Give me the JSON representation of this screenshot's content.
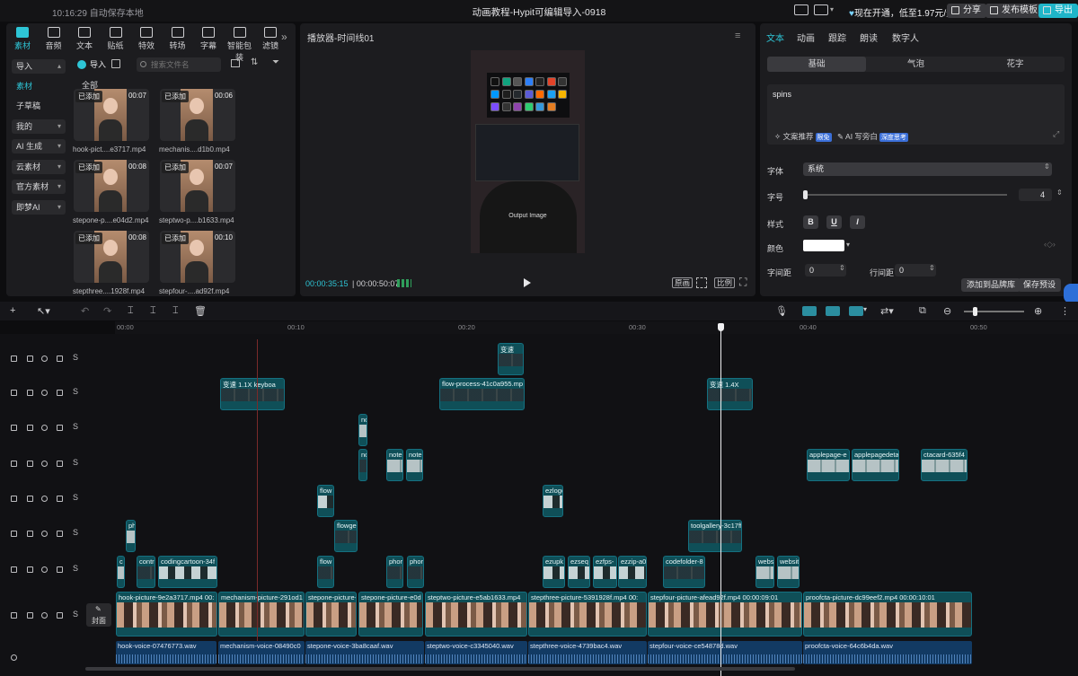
{
  "topbar": {
    "time": "10:16:29",
    "save_status": "自动保存本地",
    "title": "动画教程-Hypit可编辑导入-0918",
    "vip_text": "现在开通，低至1.97元/天",
    "share": "分享",
    "publish": "发布模板",
    "export": "导出"
  },
  "media_tabs": [
    "素材",
    "音频",
    "文本",
    "贴纸",
    "特效",
    "转场",
    "字幕",
    "智能包装",
    "滤镜"
  ],
  "sidebar": {
    "items": [
      {
        "label": "导入",
        "boxed": true,
        "dropdown": true
      },
      {
        "label": "素材",
        "boxed": false
      },
      {
        "label": "子草稿",
        "boxed": false
      },
      {
        "label": "我的",
        "boxed": true,
        "dropdown": true
      },
      {
        "label": "AI 生成",
        "boxed": true,
        "dropdown": true
      },
      {
        "label": "云素材",
        "boxed": true,
        "dropdown": true
      },
      {
        "label": "官方素材",
        "boxed": true,
        "dropdown": true
      },
      {
        "label": "即梦AI",
        "boxed": true,
        "dropdown": true
      }
    ]
  },
  "media": {
    "import_label": "导入",
    "search_placeholder": "搜索文件名",
    "all_label": "全部",
    "added_label": "已添加",
    "items": [
      {
        "name": "hook-pict....e3717.mp4",
        "duration": "00:07"
      },
      {
        "name": "mechanis....d1b0.mp4",
        "duration": "00:06"
      },
      {
        "name": "stepone-p....e04d2.mp4",
        "duration": "00:08"
      },
      {
        "name": "steptwo-p....b1633.mp4",
        "duration": "00:07"
      },
      {
        "name": "stepthree....1928f.mp4",
        "duration": "00:08"
      },
      {
        "name": "stepfour-....ad92f.mp4",
        "duration": "00:10"
      }
    ]
  },
  "player": {
    "title": "播放器-时间线01",
    "current_time": "00:00:35:15",
    "total_time": "00:00:50:07",
    "btn_original": "原画",
    "btn_ratio": "比例",
    "overlay_text": "Output Image"
  },
  "right_panel": {
    "tabs": [
      "文本",
      "动画",
      "跟踪",
      "朗读",
      "数字人"
    ],
    "segments": [
      "基础",
      "气泡",
      "花字"
    ],
    "text_value": "spins",
    "suggest1": "文案推荐",
    "suggest1_badge": "限免",
    "suggest2": "AI 写旁白",
    "suggest2_badge": "深度思考",
    "font_label": "字体",
    "font_value": "系统",
    "size_label": "字号",
    "size_value": "4",
    "size_fraction": 0.0,
    "style_label": "样式",
    "style_buttons": [
      "B",
      "U",
      "I"
    ],
    "color_label": "颜色",
    "color_value": "#ffffff",
    "spacing_label": "字间距",
    "spacing_value": "0",
    "line_spacing_label": "行间距",
    "line_spacing_value": "0",
    "btn_brand": "添加到品牌库",
    "btn_preset": "保存预设"
  },
  "ruler": [
    "00:00",
    "00:10",
    "00:20",
    "00:30",
    "00:40",
    "00:50"
  ],
  "cover_label": "封面",
  "tracks": {
    "t1": [
      {
        "label": "变速",
        "style": "dark"
      }
    ],
    "t2": [
      {
        "label": "变速 1.1X  keyboa",
        "style": "dark"
      },
      {
        "label": "flow-process-41c0a955.mp",
        "style": "dark"
      },
      {
        "label": "变速 1.4X",
        "style": "dark"
      }
    ],
    "t3": [
      {
        "label": "nc",
        "style": "light"
      }
    ],
    "t4": [
      {
        "label": "nc",
        "style": "dark"
      },
      {
        "label": "note",
        "style": "light"
      },
      {
        "label": "note",
        "style": "light"
      },
      {
        "label": "applepage-e",
        "style": "light"
      },
      {
        "label": "applepagedeta",
        "style": "light"
      },
      {
        "label": "ctacard-635f4",
        "style": "light"
      }
    ],
    "t5": [
      {
        "label": "flow",
        "style": "mix"
      },
      {
        "label": "ezlogo",
        "style": "mix"
      }
    ],
    "t6": [
      {
        "label": "ph",
        "style": "light"
      },
      {
        "label": "flowge",
        "style": "dark"
      },
      {
        "label": "toolgallery-3c17ff",
        "style": "dark"
      }
    ],
    "t7": [
      {
        "label": "c",
        "style": "light"
      },
      {
        "label": "contr",
        "style": "dark"
      },
      {
        "label": "codingcartoon-34f",
        "style": "mix"
      },
      {
        "label": "flow",
        "style": "dark"
      },
      {
        "label": "phor",
        "style": "dark"
      },
      {
        "label": "phor",
        "style": "dark"
      },
      {
        "label": "ezupk",
        "style": "mix"
      },
      {
        "label": "ezseq",
        "style": "mix"
      },
      {
        "label": "ezfps-",
        "style": "mix"
      },
      {
        "label": "ezzip-a0",
        "style": "mix"
      },
      {
        "label": "codefolder-8",
        "style": "dark"
      },
      {
        "label": "websi",
        "style": "light"
      },
      {
        "label": "websit",
        "style": "light"
      }
    ],
    "main": [
      {
        "label": "hook-picture-9e2a3717.mp4  00:"
      },
      {
        "label": "mechanism-picture-291od1"
      },
      {
        "label": "stepone-picture-"
      },
      {
        "label": "stepone-picture-e0d"
      },
      {
        "label": "steptwo-picture-e5ab1633.mp4"
      },
      {
        "label": "stepthree-picture-5391928f.mp4  00:"
      },
      {
        "label": "stepfour-picture-afead92f.mp4  00:00:09:01"
      },
      {
        "label": "proofcta-picture-dc99eef2.mp4  00:00:10:01"
      }
    ],
    "audio": [
      {
        "label": "hook-voice-07476773.wav"
      },
      {
        "label": "mechanism-voice-08490c0"
      },
      {
        "label": "stepone-voice-3ba8caaf.wav"
      },
      {
        "label": "steptwo-voice-c3345040.wav"
      },
      {
        "label": "stepthree-voice-4739bac4.wav"
      },
      {
        "label": "stepfour-voice-ce54878d.wav"
      },
      {
        "label": "proofcta-voice-64c6b4da.wav"
      }
    ]
  },
  "icons": {
    "logo_grid": [
      "#111",
      "#10a37f",
      "#555",
      "#2d7ff9",
      "#222",
      "#e24329",
      "#333",
      "#0098ff",
      "#1e1e1e",
      "#24292e",
      "#5b5bd6",
      "#ff6a00",
      "#1da1f2",
      "#f7b500",
      "#7b4dff",
      "#333",
      "#8e44ad",
      "#2ecc71",
      "#3498db",
      "#e67e22"
    ]
  }
}
